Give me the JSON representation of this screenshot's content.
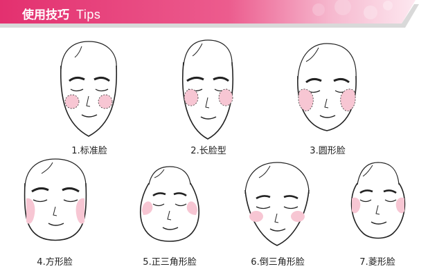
{
  "header": {
    "title_zh": "使用技巧",
    "title_en": "Tips",
    "colors": {
      "banner": "#e6367a",
      "accent_bg": "#f7d6e3"
    }
  },
  "faces": [
    {
      "label": "1.标准脸",
      "shape": "standard"
    },
    {
      "label": "2.长脸型",
      "shape": "long"
    },
    {
      "label": "3.圆形脸",
      "shape": "round"
    },
    {
      "label": "4.方形脸",
      "shape": "square"
    },
    {
      "label": "5.正三角形脸",
      "shape": "triangle"
    },
    {
      "label": "6.倒三角形脸",
      "shape": "inverted-triangle"
    },
    {
      "label": "7.菱形脸",
      "shape": "diamond"
    }
  ],
  "colors": {
    "blush": "#f7c6d3",
    "line": "#222222"
  }
}
